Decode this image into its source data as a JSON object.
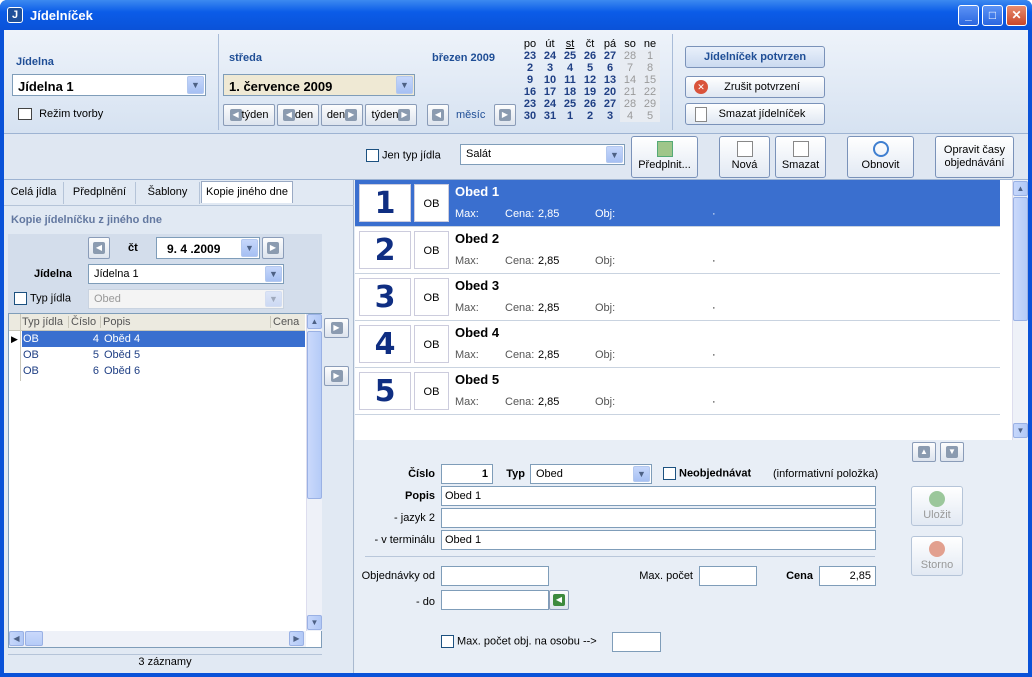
{
  "window": {
    "title": "Jídelníček"
  },
  "top": {
    "jidelna_label": "Jídelna",
    "jidelna_value": "Jídelna 1",
    "mode_label": "Režim tvorby",
    "day_label": "středa",
    "date_value": "1. července 2009",
    "nav": {
      "week_prev": "týden",
      "day_prev": "den",
      "day_next": "den",
      "week_next": "týden",
      "month": "měsíc"
    },
    "month_label": "březen 2009",
    "cal_headers": [
      "po",
      "út",
      "st",
      "čt",
      "pá",
      "so",
      "ne"
    ],
    "cal_rows": [
      [
        "23",
        "24",
        "25",
        "26",
        "27",
        "28",
        "1"
      ],
      [
        "2",
        "3",
        "4",
        "5",
        "6",
        "7",
        "8"
      ],
      [
        "9",
        "10",
        "11",
        "12",
        "13",
        "14",
        "15"
      ],
      [
        "16",
        "17",
        "18",
        "19",
        "20",
        "21",
        "22"
      ],
      [
        "23",
        "24",
        "25",
        "26",
        "27",
        "28",
        "29"
      ],
      [
        "30",
        "31",
        "1",
        "2",
        "3",
        "4",
        "5"
      ]
    ],
    "confirmed_label": "Jídelníček potvrzen",
    "cancel_confirm": "Zrušit potvrzení",
    "delete_menu": "Smazat jídelníček"
  },
  "toolbar": {
    "only_type_label": "Jen typ jídla",
    "type_value": "Salát",
    "prefill": "Předplnit...",
    "new": "Nová",
    "delete": "Smazat",
    "refresh": "Obnovit",
    "fix_times": "Opravit časy objednávání"
  },
  "left": {
    "tabs": [
      "Celá jídla",
      "Předplnění",
      "Šablony",
      "Kopie jiného dne"
    ],
    "section_title": "Kopie jídelníčku z jiného dne",
    "day_abbr": "čt",
    "date": "9. 4 .2009",
    "jidelna_label": "Jídelna",
    "jidelna_value": "Jídelna 1",
    "type_label": "Typ jídla",
    "type_value": "Obed",
    "grid_headers": [
      "Typ jídla",
      "Číslo",
      "Popis",
      "Cena"
    ],
    "grid_rows": [
      {
        "typ": "OB",
        "cislo": "4",
        "popis": "Oběd 4"
      },
      {
        "typ": "OB",
        "cislo": "5",
        "popis": "Oběd 5"
      },
      {
        "typ": "OB",
        "cislo": "6",
        "popis": "Oběd 6"
      }
    ],
    "status": "3 záznamy"
  },
  "meals": [
    {
      "num": "1",
      "typ": "OB",
      "name": "Obed 1",
      "max": "Max:",
      "cena_lbl": "Cena:",
      "cena": "2,85",
      "obj": "Obj:",
      "dot": "·"
    },
    {
      "num": "2",
      "typ": "OB",
      "name": "Obed 2",
      "max": "Max:",
      "cena_lbl": "Cena:",
      "cena": "2,85",
      "obj": "Obj:",
      "dot": "·"
    },
    {
      "num": "3",
      "typ": "OB",
      "name": "Obed 3",
      "max": "Max:",
      "cena_lbl": "Cena:",
      "cena": "2,85",
      "obj": "Obj:",
      "dot": "·"
    },
    {
      "num": "4",
      "typ": "OB",
      "name": "Obed 4",
      "max": "Max:",
      "cena_lbl": "Cena:",
      "cena": "2,85",
      "obj": "Obj:",
      "dot": "·"
    },
    {
      "num": "5",
      "typ": "OB",
      "name": "Obed 5",
      "max": "Max:",
      "cena_lbl": "Cena:",
      "cena": "2,85",
      "obj": "Obj:",
      "dot": "·"
    }
  ],
  "detail": {
    "cislo_label": "Číslo",
    "cislo": "1",
    "typ_label": "Typ",
    "typ_value": "Obed",
    "neobj_label": "Neobjednávat",
    "info_label": "(informativní položka)",
    "popis_label": "Popis",
    "popis": "Obed 1",
    "jazyk2_label": "- jazyk 2",
    "jazyk2": "",
    "terminal_label": "- v terminálu",
    "terminal": "Obed 1",
    "obj_od_label": "Objednávky od",
    "obj_do_label": "- do",
    "max_pocet_label": "Max. počet",
    "cena_label": "Cena",
    "cena": "2,85",
    "max_osobu_label": "Max. počet obj. na osobu -->",
    "save": "Uložit",
    "storno": "Storno"
  }
}
